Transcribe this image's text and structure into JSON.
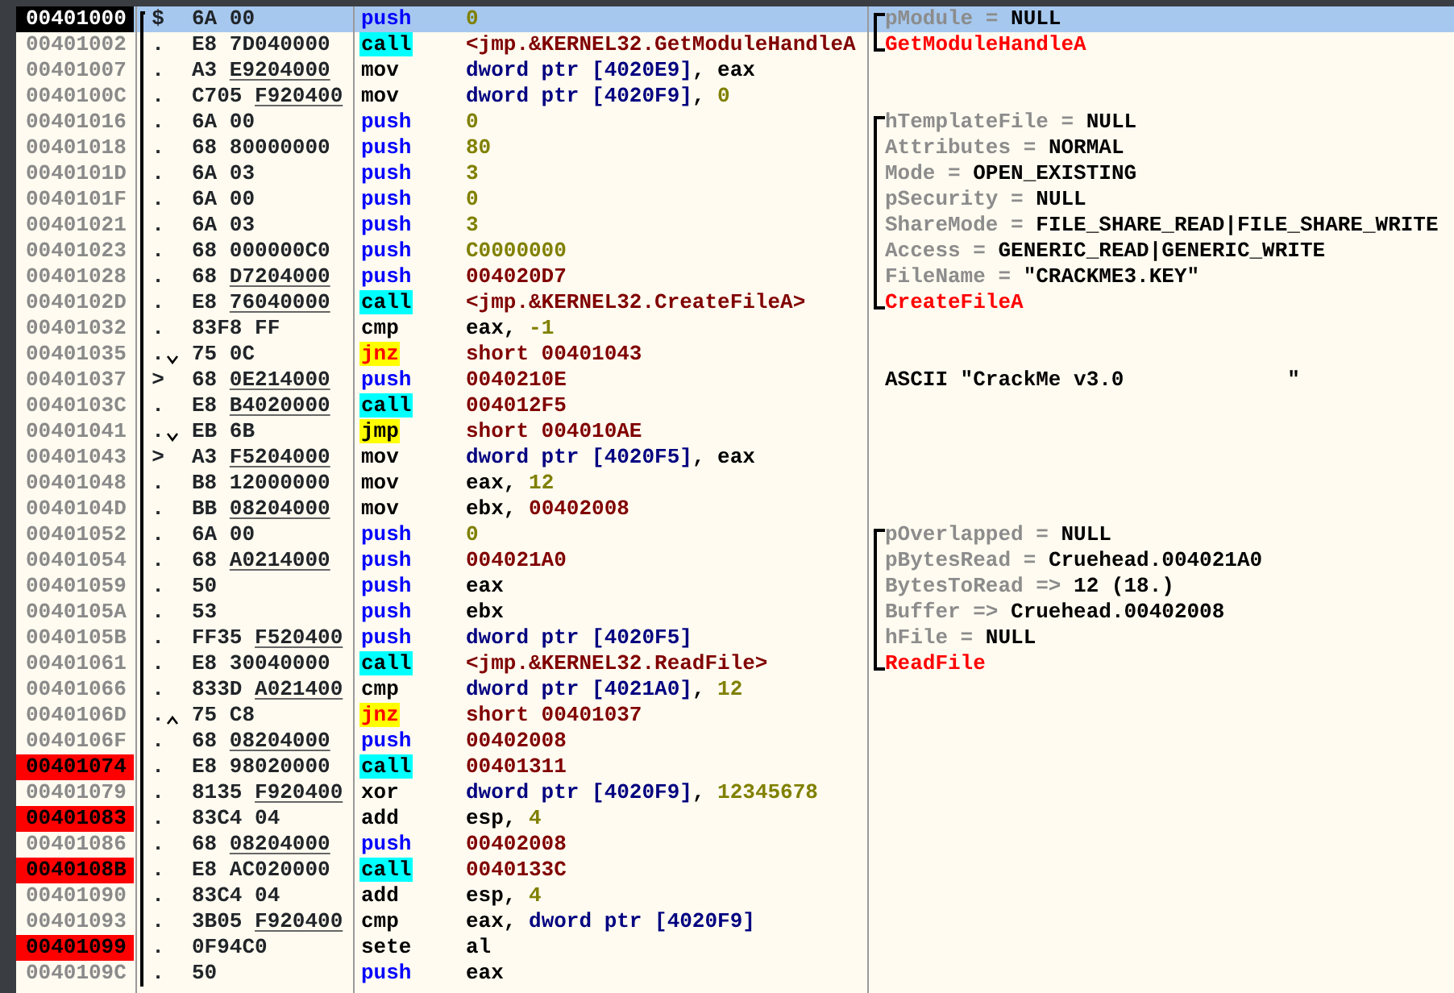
{
  "rows": [
    {
      "address": "00401000",
      "marker": "$",
      "proc_start": true,
      "selected": true,
      "breakpoint": false,
      "op": "6A",
      "bytes": "00",
      "reloc": false,
      "mnemonic": {
        "text": "push",
        "kind": "push"
      },
      "operand": [
        {
          "kind": "const",
          "text": "0"
        }
      ],
      "comment": {
        "kind": "param",
        "name": "pModule =",
        "value": "NULL"
      }
    },
    {
      "address": "00401002",
      "marker": ".",
      "proc_start": false,
      "selected": false,
      "breakpoint": false,
      "op": "E8",
      "bytes": "7D040000",
      "reloc": false,
      "mnemonic": {
        "text": "call",
        "kind": "call"
      },
      "operand": [
        {
          "kind": "addr",
          "text": "<jmp.&KERNEL32.GetModuleHandleA"
        }
      ],
      "comment": {
        "kind": "api",
        "text": "GetModuleHandleA"
      }
    },
    {
      "address": "00401007",
      "marker": ".",
      "proc_start": false,
      "selected": false,
      "breakpoint": false,
      "op": "A3",
      "bytes": "E9204000",
      "reloc": true,
      "mnemonic": {
        "text": "mov",
        "kind": "plain"
      },
      "operand": [
        {
          "kind": "mem",
          "text": "dword ptr [4020E9]"
        },
        {
          "kind": "reg",
          "text": ", eax"
        }
      ]
    },
    {
      "address": "0040100C",
      "marker": ".",
      "proc_start": false,
      "selected": false,
      "breakpoint": false,
      "op": "C705",
      "bytes": "F920400",
      "reloc": true,
      "mnemonic": {
        "text": "mov",
        "kind": "plain"
      },
      "operand": [
        {
          "kind": "mem",
          "text": "dword ptr [4020F9]"
        },
        {
          "kind": "reg",
          "text": ", "
        },
        {
          "kind": "const",
          "text": "0"
        }
      ]
    },
    {
      "address": "00401016",
      "marker": ".",
      "proc_start": false,
      "selected": false,
      "breakpoint": false,
      "op": "6A",
      "bytes": "00",
      "reloc": false,
      "mnemonic": {
        "text": "push",
        "kind": "push"
      },
      "operand": [
        {
          "kind": "const",
          "text": "0"
        }
      ],
      "comment": {
        "kind": "param",
        "name": "hTemplateFile =",
        "value": "NULL"
      }
    },
    {
      "address": "00401018",
      "marker": ".",
      "proc_start": false,
      "selected": false,
      "breakpoint": false,
      "op": "68",
      "bytes": "80000000",
      "reloc": false,
      "mnemonic": {
        "text": "push",
        "kind": "push"
      },
      "operand": [
        {
          "kind": "const",
          "text": "80"
        }
      ],
      "comment": {
        "kind": "param",
        "name": "Attributes =",
        "value": "NORMAL"
      }
    },
    {
      "address": "0040101D",
      "marker": ".",
      "proc_start": false,
      "selected": false,
      "breakpoint": false,
      "op": "6A",
      "bytes": "03",
      "reloc": false,
      "mnemonic": {
        "text": "push",
        "kind": "push"
      },
      "operand": [
        {
          "kind": "const",
          "text": "3"
        }
      ],
      "comment": {
        "kind": "param",
        "name": "Mode =",
        "value": "OPEN_EXISTING"
      }
    },
    {
      "address": "0040101F",
      "marker": ".",
      "proc_start": false,
      "selected": false,
      "breakpoint": false,
      "op": "6A",
      "bytes": "00",
      "reloc": false,
      "mnemonic": {
        "text": "push",
        "kind": "push"
      },
      "operand": [
        {
          "kind": "const",
          "text": "0"
        }
      ],
      "comment": {
        "kind": "param",
        "name": "pSecurity =",
        "value": "NULL"
      }
    },
    {
      "address": "00401021",
      "marker": ".",
      "proc_start": false,
      "selected": false,
      "breakpoint": false,
      "op": "6A",
      "bytes": "03",
      "reloc": false,
      "mnemonic": {
        "text": "push",
        "kind": "push"
      },
      "operand": [
        {
          "kind": "const",
          "text": "3"
        }
      ],
      "comment": {
        "kind": "param",
        "name": "ShareMode =",
        "value": "FILE_SHARE_READ|FILE_SHARE_WRITE"
      }
    },
    {
      "address": "00401023",
      "marker": ".",
      "proc_start": false,
      "selected": false,
      "breakpoint": false,
      "op": "68",
      "bytes": "000000C0",
      "reloc": false,
      "mnemonic": {
        "text": "push",
        "kind": "push"
      },
      "operand": [
        {
          "kind": "const",
          "text": "C0000000"
        }
      ],
      "comment": {
        "kind": "param",
        "name": "Access =",
        "value": "GENERIC_READ|GENERIC_WRITE"
      }
    },
    {
      "address": "00401028",
      "marker": ".",
      "proc_start": false,
      "selected": false,
      "breakpoint": false,
      "op": "68",
      "bytes": "D7204000",
      "reloc": true,
      "mnemonic": {
        "text": "push",
        "kind": "push"
      },
      "operand": [
        {
          "kind": "addr",
          "text": "004020D7"
        }
      ],
      "comment": {
        "kind": "param",
        "name": "FileName =",
        "value": "\"CRACKME3.KEY\""
      }
    },
    {
      "address": "0040102D",
      "marker": ".",
      "proc_start": false,
      "selected": false,
      "breakpoint": false,
      "op": "E8",
      "bytes": "76040000",
      "reloc": true,
      "mnemonic": {
        "text": "call",
        "kind": "call"
      },
      "operand": [
        {
          "kind": "addr",
          "text": "<jmp.&KERNEL32.CreateFileA>"
        }
      ],
      "comment": {
        "kind": "api",
        "text": "CreateFileA"
      }
    },
    {
      "address": "00401032",
      "marker": ".",
      "proc_start": false,
      "selected": false,
      "breakpoint": false,
      "op": "83F8",
      "bytes": "FF",
      "reloc": false,
      "mnemonic": {
        "text": "cmp",
        "kind": "plain"
      },
      "operand": [
        {
          "kind": "reg",
          "text": "eax, "
        },
        {
          "kind": "const",
          "text": "-1"
        }
      ]
    },
    {
      "address": "00401035",
      "marker": ".",
      "jump": {
        "kind": "down"
      },
      "proc_start": false,
      "selected": false,
      "breakpoint": false,
      "op": "75",
      "bytes": "0C",
      "reloc": false,
      "mnemonic": {
        "text": "jnz",
        "kind": "jcc"
      },
      "operand": [
        {
          "kind": "addr",
          "text": "short 00401043"
        }
      ]
    },
    {
      "address": "00401037",
      "marker": ">",
      "proc_start": false,
      "selected": false,
      "breakpoint": false,
      "op": "68",
      "bytes": "0E214000",
      "reloc": true,
      "mnemonic": {
        "text": "push",
        "kind": "push"
      },
      "operand": [
        {
          "kind": "addr",
          "text": "0040210E"
        }
      ],
      "comment": {
        "kind": "text",
        "text": "ASCII \"CrackMe v3.0             \""
      }
    },
    {
      "address": "0040103C",
      "marker": ".",
      "proc_start": false,
      "selected": false,
      "breakpoint": false,
      "op": "E8",
      "bytes": "B4020000",
      "reloc": true,
      "mnemonic": {
        "text": "call",
        "kind": "call"
      },
      "operand": [
        {
          "kind": "addr",
          "text": "004012F5"
        }
      ]
    },
    {
      "address": "00401041",
      "marker": ".",
      "jump": {
        "kind": "down"
      },
      "proc_start": false,
      "selected": false,
      "breakpoint": false,
      "op": "EB",
      "bytes": "6B",
      "reloc": false,
      "mnemonic": {
        "text": "jmp",
        "kind": "jmp"
      },
      "operand": [
        {
          "kind": "addr",
          "text": "short 004010AE"
        }
      ]
    },
    {
      "address": "00401043",
      "marker": ">",
      "proc_start": false,
      "selected": false,
      "breakpoint": false,
      "op": "A3",
      "bytes": "F5204000",
      "reloc": true,
      "mnemonic": {
        "text": "mov",
        "kind": "plain"
      },
      "operand": [
        {
          "kind": "mem",
          "text": "dword ptr [4020F5]"
        },
        {
          "kind": "reg",
          "text": ", eax"
        }
      ]
    },
    {
      "address": "00401048",
      "marker": ".",
      "proc_start": false,
      "selected": false,
      "breakpoint": false,
      "op": "B8",
      "bytes": "12000000",
      "reloc": false,
      "mnemonic": {
        "text": "mov",
        "kind": "plain"
      },
      "operand": [
        {
          "kind": "reg",
          "text": "eax, "
        },
        {
          "kind": "const",
          "text": "12"
        }
      ]
    },
    {
      "address": "0040104D",
      "marker": ".",
      "proc_start": false,
      "selected": false,
      "breakpoint": false,
      "op": "BB",
      "bytes": "08204000",
      "reloc": true,
      "mnemonic": {
        "text": "mov",
        "kind": "plain"
      },
      "operand": [
        {
          "kind": "reg",
          "text": "ebx, "
        },
        {
          "kind": "addr",
          "text": "00402008"
        }
      ]
    },
    {
      "address": "00401052",
      "marker": ".",
      "proc_start": false,
      "selected": false,
      "breakpoint": false,
      "op": "6A",
      "bytes": "00",
      "reloc": false,
      "mnemonic": {
        "text": "push",
        "kind": "push"
      },
      "operand": [
        {
          "kind": "const",
          "text": "0"
        }
      ],
      "comment": {
        "kind": "param",
        "name": "pOverlapped =",
        "value": "NULL"
      }
    },
    {
      "address": "00401054",
      "marker": ".",
      "proc_start": false,
      "selected": false,
      "breakpoint": false,
      "op": "68",
      "bytes": "A0214000",
      "reloc": true,
      "mnemonic": {
        "text": "push",
        "kind": "push"
      },
      "operand": [
        {
          "kind": "addr",
          "text": "004021A0"
        }
      ],
      "comment": {
        "kind": "param",
        "name": "pBytesRead =",
        "value": "Cruehead.004021A0"
      }
    },
    {
      "address": "00401059",
      "marker": ".",
      "proc_start": false,
      "selected": false,
      "breakpoint": false,
      "op": "50",
      "mnemonic": {
        "text": "push",
        "kind": "push"
      },
      "operand": [
        {
          "kind": "reg",
          "text": "eax"
        }
      ],
      "comment": {
        "kind": "param",
        "name": "BytesToRead =>",
        "value": "12 (18.)"
      }
    },
    {
      "address": "0040105A",
      "marker": ".",
      "proc_start": false,
      "selected": false,
      "breakpoint": false,
      "op": "53",
      "mnemonic": {
        "text": "push",
        "kind": "push"
      },
      "operand": [
        {
          "kind": "reg",
          "text": "ebx"
        }
      ],
      "comment": {
        "kind": "param",
        "name": "Buffer =>",
        "value": "Cruehead.00402008"
      }
    },
    {
      "address": "0040105B",
      "marker": ".",
      "proc_start": false,
      "selected": false,
      "breakpoint": false,
      "op": "FF35",
      "bytes": "F520400",
      "reloc": true,
      "mnemonic": {
        "text": "push",
        "kind": "push"
      },
      "operand": [
        {
          "kind": "mem",
          "text": "dword ptr [4020F5]"
        }
      ],
      "comment": {
        "kind": "param",
        "name": "hFile =",
        "value": "NULL"
      }
    },
    {
      "address": "00401061",
      "marker": ".",
      "proc_start": false,
      "selected": false,
      "breakpoint": false,
      "op": "E8",
      "bytes": "30040000",
      "reloc": false,
      "mnemonic": {
        "text": "call",
        "kind": "call"
      },
      "operand": [
        {
          "kind": "addr",
          "text": "<jmp.&KERNEL32.ReadFile>"
        }
      ],
      "comment": {
        "kind": "api",
        "text": "ReadFile"
      }
    },
    {
      "address": "00401066",
      "marker": ".",
      "proc_start": false,
      "selected": false,
      "breakpoint": false,
      "op": "833D",
      "bytes": "A021400",
      "reloc": true,
      "mnemonic": {
        "text": "cmp",
        "kind": "plain"
      },
      "operand": [
        {
          "kind": "mem",
          "text": "dword ptr [4021A0]"
        },
        {
          "kind": "reg",
          "text": ", "
        },
        {
          "kind": "const",
          "text": "12"
        }
      ]
    },
    {
      "address": "0040106D",
      "marker": ".",
      "jump": {
        "kind": "up"
      },
      "proc_start": false,
      "selected": false,
      "breakpoint": false,
      "op": "75",
      "bytes": "C8",
      "reloc": false,
      "mnemonic": {
        "text": "jnz",
        "kind": "jcc"
      },
      "operand": [
        {
          "kind": "addr",
          "text": "short 00401037"
        }
      ]
    },
    {
      "address": "0040106F",
      "marker": ".",
      "proc_start": false,
      "selected": false,
      "breakpoint": false,
      "op": "68",
      "bytes": "08204000",
      "reloc": true,
      "mnemonic": {
        "text": "push",
        "kind": "push"
      },
      "operand": [
        {
          "kind": "addr",
          "text": "00402008"
        }
      ]
    },
    {
      "address": "00401074",
      "marker": ".",
      "proc_start": false,
      "selected": false,
      "breakpoint": true,
      "op": "E8",
      "bytes": "98020000",
      "reloc": false,
      "mnemonic": {
        "text": "call",
        "kind": "call"
      },
      "operand": [
        {
          "kind": "addr",
          "text": "00401311"
        }
      ]
    },
    {
      "address": "00401079",
      "marker": ".",
      "proc_start": false,
      "selected": false,
      "breakpoint": false,
      "op": "8135",
      "bytes": "F920400",
      "reloc": true,
      "mnemonic": {
        "text": "xor",
        "kind": "plain"
      },
      "operand": [
        {
          "kind": "mem",
          "text": "dword ptr [4020F9]"
        },
        {
          "kind": "reg",
          "text": ", "
        },
        {
          "kind": "const",
          "text": "12345678"
        }
      ]
    },
    {
      "address": "00401083",
      "marker": ".",
      "proc_start": false,
      "selected": false,
      "breakpoint": true,
      "op": "83C4",
      "bytes": "04",
      "reloc": false,
      "mnemonic": {
        "text": "add",
        "kind": "plain"
      },
      "operand": [
        {
          "kind": "reg",
          "text": "esp, "
        },
        {
          "kind": "const",
          "text": "4"
        }
      ]
    },
    {
      "address": "00401086",
      "marker": ".",
      "proc_start": false,
      "selected": false,
      "breakpoint": false,
      "op": "68",
      "bytes": "08204000",
      "reloc": true,
      "mnemonic": {
        "text": "push",
        "kind": "push"
      },
      "operand": [
        {
          "kind": "addr",
          "text": "00402008"
        }
      ]
    },
    {
      "address": "0040108B",
      "marker": ".",
      "proc_start": false,
      "selected": false,
      "breakpoint": true,
      "op": "E8",
      "bytes": "AC020000",
      "reloc": false,
      "mnemonic": {
        "text": "call",
        "kind": "call"
      },
      "operand": [
        {
          "kind": "addr",
          "text": "0040133C"
        }
      ]
    },
    {
      "address": "00401090",
      "marker": ".",
      "proc_start": false,
      "selected": false,
      "breakpoint": false,
      "op": "83C4",
      "bytes": "04",
      "reloc": false,
      "mnemonic": {
        "text": "add",
        "kind": "plain"
      },
      "operand": [
        {
          "kind": "reg",
          "text": "esp, "
        },
        {
          "kind": "const",
          "text": "4"
        }
      ]
    },
    {
      "address": "00401093",
      "marker": ".",
      "proc_start": false,
      "selected": false,
      "breakpoint": false,
      "op": "3B05",
      "bytes": "F920400",
      "reloc": true,
      "mnemonic": {
        "text": "cmp",
        "kind": "plain"
      },
      "operand": [
        {
          "kind": "reg",
          "text": "eax, "
        },
        {
          "kind": "mem",
          "text": "dword ptr [4020F9]"
        }
      ]
    },
    {
      "address": "00401099",
      "marker": ".",
      "proc_start": false,
      "selected": false,
      "breakpoint": true,
      "op": "0F94C0",
      "mnemonic": {
        "text": "sete",
        "kind": "plain"
      },
      "operand": [
        {
          "kind": "reg",
          "text": "al"
        }
      ]
    },
    {
      "address": "0040109C",
      "marker": ".",
      "proc_start": false,
      "selected": false,
      "breakpoint": false,
      "op": "50",
      "mnemonic": {
        "text": "push",
        "kind": "push"
      },
      "operand": [
        {
          "kind": "reg",
          "text": "eax"
        }
      ]
    }
  ]
}
